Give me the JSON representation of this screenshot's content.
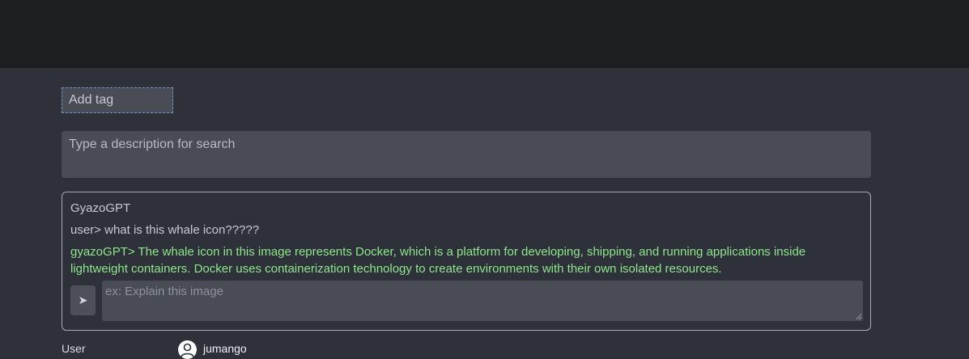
{
  "tag_input": {
    "placeholder": "Add tag"
  },
  "search": {
    "placeholder": "Type a description for search"
  },
  "gpt_panel": {
    "title": "GyazoGPT",
    "user_message": "user> what is this whale icon?????",
    "bot_message": "gyazoGPT> The whale icon in this image represents Docker, which is a platform for developing, shipping, and running applications inside lightweight containers. Docker uses containerization technology to create environments with their own isolated resources.",
    "send_icon": "send-arrow-icon",
    "prompt_placeholder": "ex: Explain this image"
  },
  "user_row": {
    "label": "User",
    "username": "jumango",
    "avatar_icon": "user-avatar-icon"
  },
  "colors": {
    "topbar": "#1d1e22",
    "background": "#2e3139",
    "field": "#494c55",
    "bot_text": "#8ee68c",
    "tag_border": "#6f95c9"
  }
}
